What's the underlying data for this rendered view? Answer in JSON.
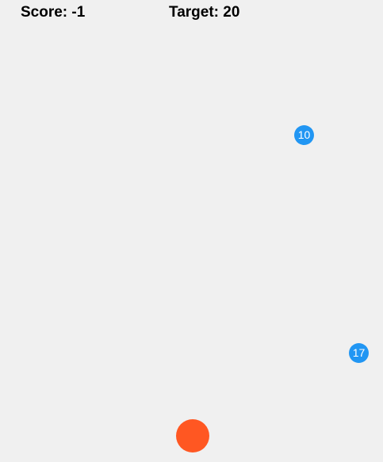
{
  "hud": {
    "score_label": "Score:",
    "score_value": "-1",
    "target_label": "Target:",
    "target_value": "20"
  },
  "balls": [
    {
      "number": "10",
      "color": "#2196f3"
    },
    {
      "number": "17",
      "color": "#2196f3"
    }
  ],
  "player": {
    "color": "#ff5722"
  },
  "colors": {
    "background": "#f0f0f0",
    "text": "#000000"
  }
}
